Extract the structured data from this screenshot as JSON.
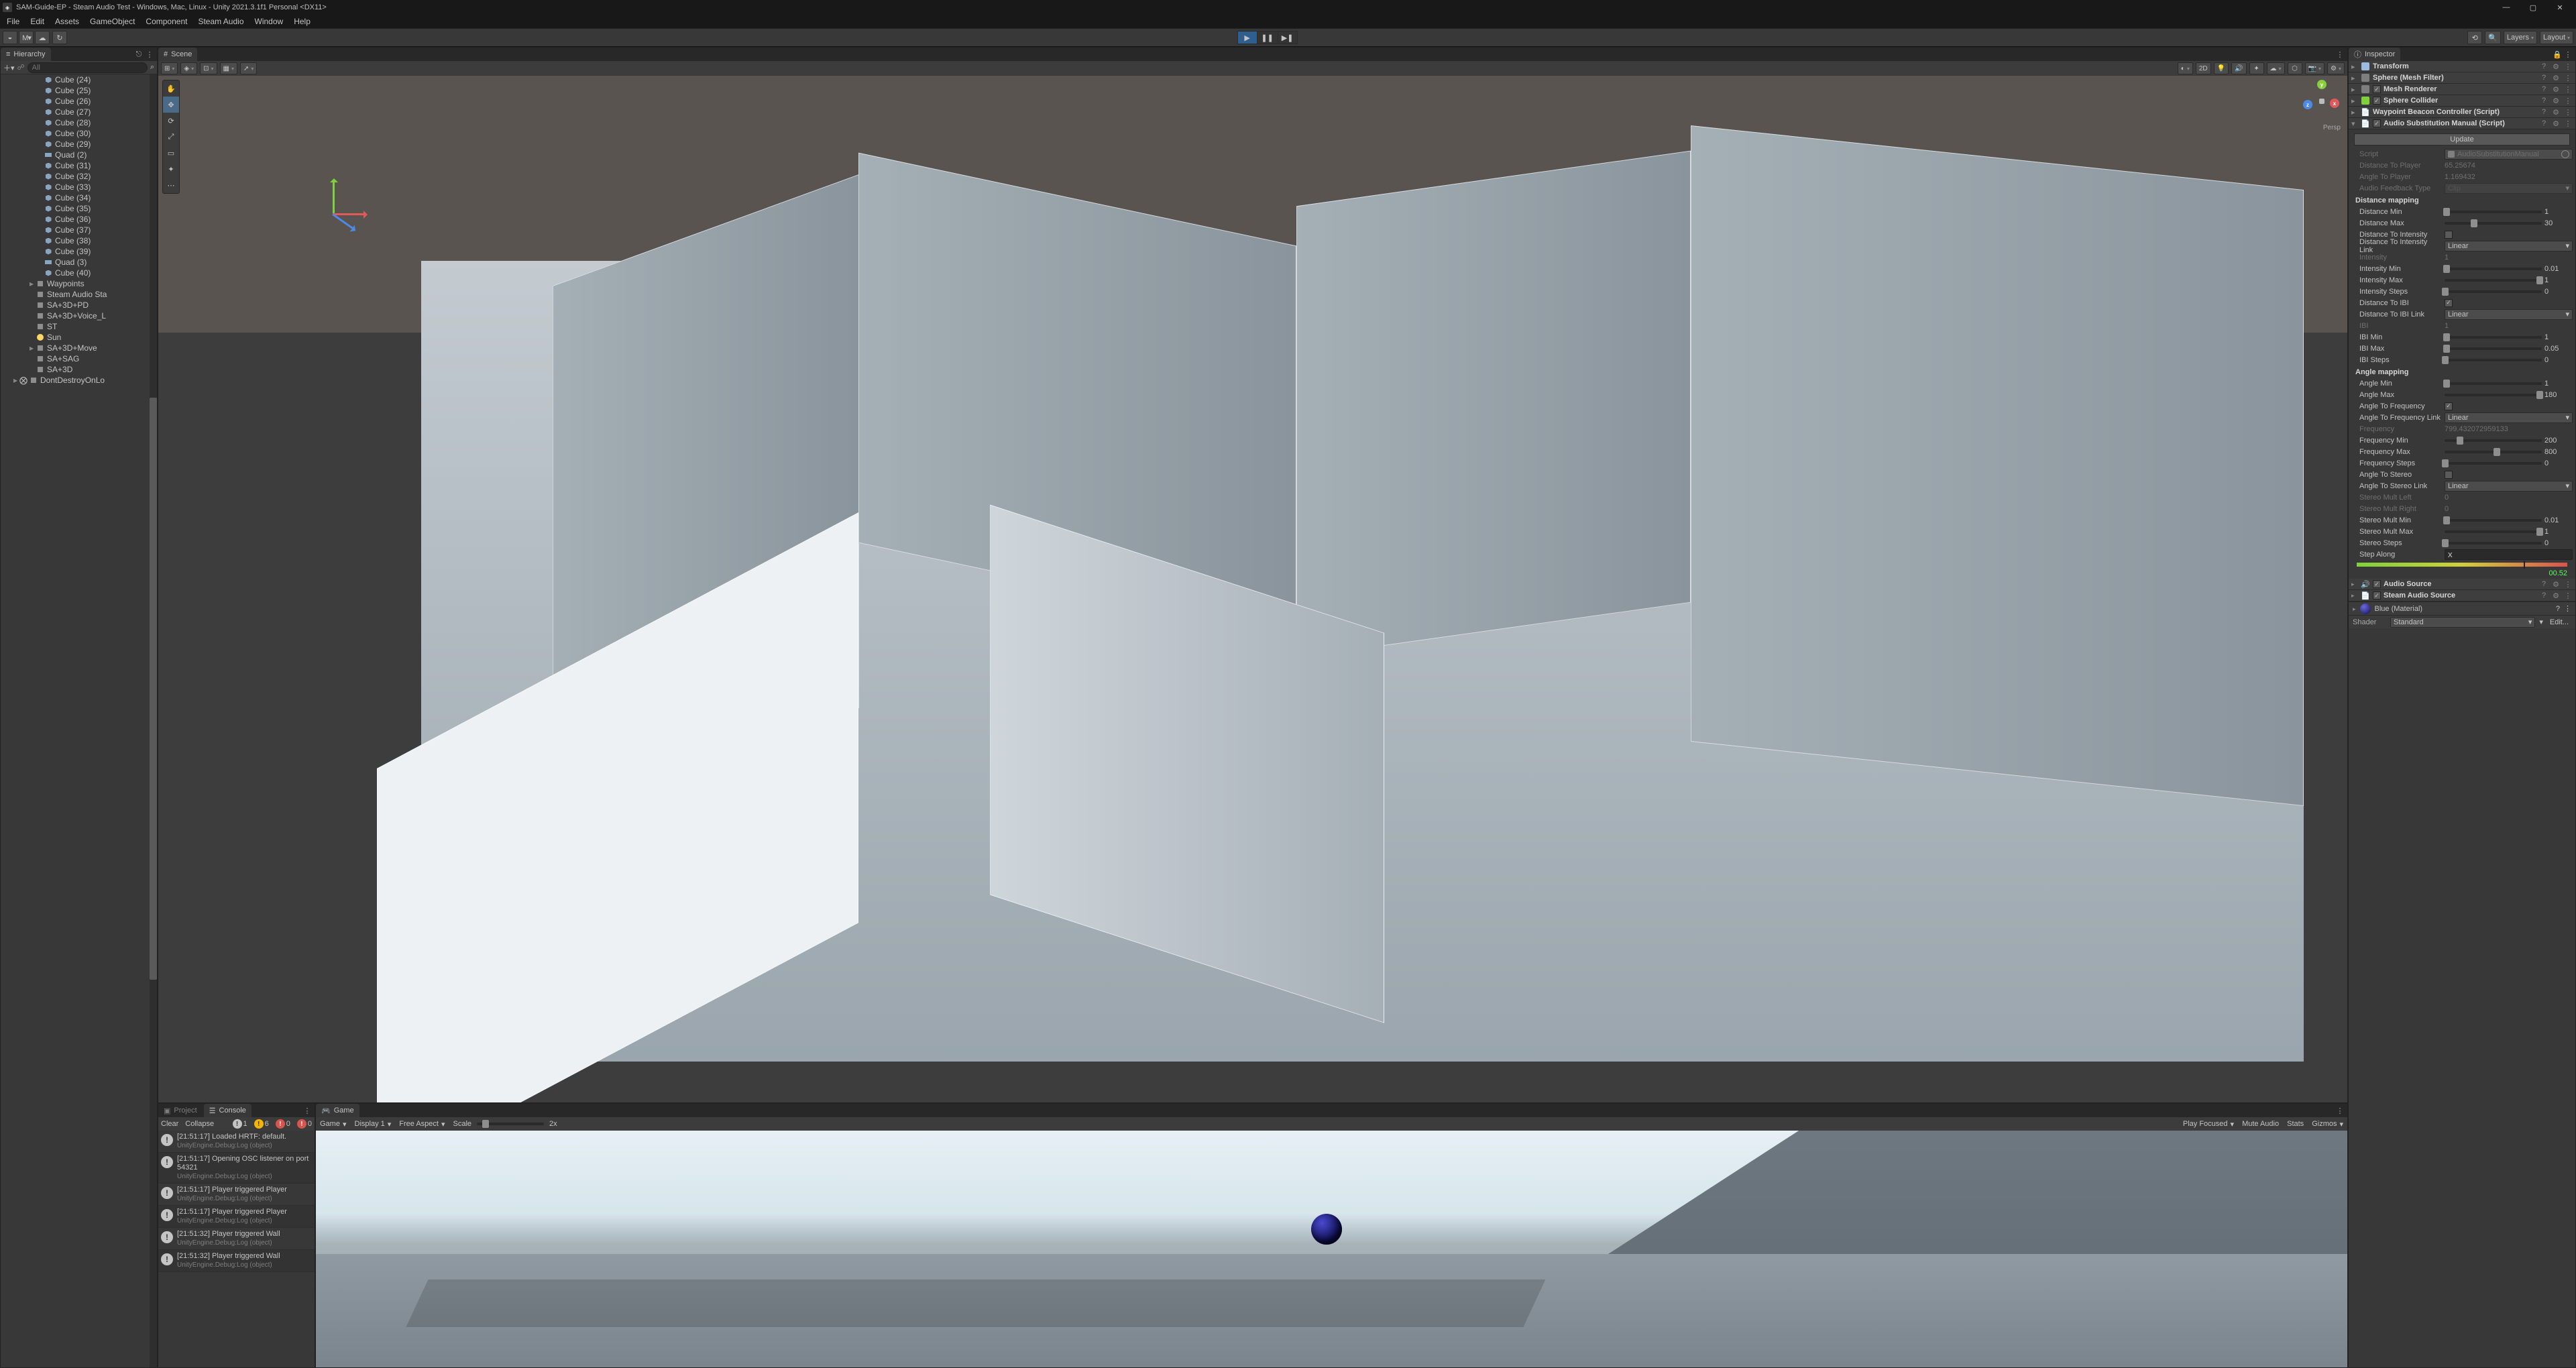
{
  "window_title": "SAM-Guide-EP - Steam Audio Test - Windows, Mac, Linux - Unity 2021.3.1f1 Personal <DX11>",
  "menu": [
    "File",
    "Edit",
    "Assets",
    "GameObject",
    "Component",
    "Steam Audio",
    "Window",
    "Help"
  ],
  "toolbar_right": {
    "layers": "Layers",
    "layout": "Layout"
  },
  "hierarchy": {
    "tab": "Hierarchy",
    "search_placeholder": "All",
    "items": [
      {
        "label": "Cube (24)",
        "icon": "cube",
        "depth": 4
      },
      {
        "label": "Cube (25)",
        "icon": "cube",
        "depth": 4
      },
      {
        "label": "Cube (26)",
        "icon": "cube",
        "depth": 4
      },
      {
        "label": "Cube (27)",
        "icon": "cube",
        "depth": 4
      },
      {
        "label": "Cube (28)",
        "icon": "cube",
        "depth": 4
      },
      {
        "label": "Cube (30)",
        "icon": "cube",
        "depth": 4
      },
      {
        "label": "Cube (29)",
        "icon": "cube",
        "depth": 4
      },
      {
        "label": "Quad (2)",
        "icon": "flat",
        "depth": 4
      },
      {
        "label": "Cube (31)",
        "icon": "cube",
        "depth": 4
      },
      {
        "label": "Cube (32)",
        "icon": "cube",
        "depth": 4
      },
      {
        "label": "Cube (33)",
        "icon": "cube",
        "depth": 4
      },
      {
        "label": "Cube (34)",
        "icon": "cube",
        "depth": 4
      },
      {
        "label": "Cube (35)",
        "icon": "cube",
        "depth": 4
      },
      {
        "label": "Cube (36)",
        "icon": "cube",
        "depth": 4
      },
      {
        "label": "Cube (37)",
        "icon": "cube",
        "depth": 4
      },
      {
        "label": "Cube (38)",
        "icon": "cube",
        "depth": 4
      },
      {
        "label": "Cube (39)",
        "icon": "cube",
        "depth": 4
      },
      {
        "label": "Quad (3)",
        "icon": "flat",
        "depth": 4
      },
      {
        "label": "Cube (40)",
        "icon": "cube",
        "depth": 4
      },
      {
        "label": "Waypoints",
        "icon": "node",
        "depth": 3,
        "exp": "▸"
      },
      {
        "label": "Steam Audio Sta",
        "icon": "node",
        "depth": 3
      },
      {
        "label": "SA+3D+PD",
        "icon": "node",
        "depth": 3
      },
      {
        "label": "SA+3D+Voice_L",
        "icon": "node",
        "depth": 3
      },
      {
        "label": "ST",
        "icon": "node",
        "depth": 3
      },
      {
        "label": "Sun",
        "icon": "light",
        "depth": 3
      },
      {
        "label": "SA+3D+Move",
        "icon": "node",
        "depth": 3,
        "exp": "▸"
      },
      {
        "label": "SA+SAG",
        "icon": "node",
        "depth": 3
      },
      {
        "label": "SA+3D",
        "icon": "node",
        "depth": 3
      },
      {
        "label": "DontDestroyOnLo",
        "icon": "node",
        "depth": 1,
        "exp": "▸",
        "pre": "⨂"
      }
    ]
  },
  "scene": {
    "tab": "Scene",
    "persp": "Persp",
    "mode_2d": "2D"
  },
  "project_console": {
    "project_tab": "Project",
    "console_tab": "Console"
  },
  "console": {
    "clear": "Clear",
    "collapse": "Collapse",
    "badges": {
      "info_count": "1",
      "warn_count": "6",
      "err_count": "0",
      "err2_count": "0"
    },
    "logs": [
      {
        "t": "[21:51:17] Loaded HRTF: default.",
        "s": "UnityEngine.Debug:Log (object)"
      },
      {
        "t": "[21:51:17] Opening OSC listener on port 54321",
        "s": "UnityEngine.Debug:Log (object)"
      },
      {
        "t": "[21:51:17] Player triggered Player",
        "s": "UnityEngine.Debug:Log (object)"
      },
      {
        "t": "[21:51:17] Player triggered Player",
        "s": "UnityEngine.Debug:Log (object)"
      },
      {
        "t": "[21:51:32] Player triggered Wall",
        "s": "UnityEngine.Debug:Log (object)"
      },
      {
        "t": "[21:51:32] Player triggered Wall",
        "s": "UnityEngine.Debug:Log (object)"
      }
    ]
  },
  "game": {
    "tab": "Game",
    "source": "Game",
    "display": "Display 1",
    "aspect": "Free Aspect",
    "scale": "Scale",
    "scale_val": "2x",
    "play_focused": "Play Focused",
    "mute": "Mute Audio",
    "stats": "Stats",
    "gizmos": "Gizmos"
  },
  "inspector": {
    "tab": "Inspector",
    "components": [
      {
        "title": "Transform",
        "fold": "▸",
        "iconcolor": "#9bbce0"
      },
      {
        "title": "Sphere (Mesh Filter)",
        "fold": "▸",
        "iconcolor": "#7e7e7e"
      },
      {
        "title": "Mesh Renderer",
        "fold": "▸",
        "chk": true,
        "iconcolor": "#7e7e7e"
      },
      {
        "title": "Sphere Collider",
        "fold": "▸",
        "chk": true,
        "iconcolor": "#7fd13b"
      },
      {
        "title": "Waypoint Beacon Controller (Script)",
        "fold": "▸",
        "iconcolor": "#c4c4c4",
        "scripticon": true
      },
      {
        "title": "Audio Substitution Manual (Script)",
        "fold": "▾",
        "chk": true,
        "iconcolor": "#c4c4c4",
        "scripticon": true
      }
    ],
    "update": "Update",
    "script_label": "Script",
    "script_value": "AudioSubstitutionManual",
    "distance_to_player_l": "Distance To Player",
    "distance_to_player_v": "65.25674",
    "angle_to_player_l": "Angle To Player",
    "angle_to_player_v": "1.169432",
    "audio_feedback_type_l": "Audio Feedback Type",
    "audio_feedback_type_v": "Clip",
    "sec_distance": "Distance mapping",
    "distance_min_l": "Distance Min",
    "distance_min_v": "1",
    "distance_max_l": "Distance Max",
    "distance_max_v": "30",
    "distance_to_intensity_l": "Distance To Intensity",
    "distance_to_intensity_link_l": "Distance To Intensity Link",
    "distance_to_intensity_link_v": "Linear",
    "intensity_l": "Intensity",
    "intensity_v": "1",
    "intensity_min_l": "Intensity Min",
    "intensity_min_v": "0.01",
    "intensity_max_l": "Intensity Max",
    "intensity_max_v": "1",
    "intensity_steps_l": "Intensity Steps",
    "intensity_steps_v": "0",
    "distance_to_ibi_l": "Distance To IBI",
    "distance_to_ibi_link_l": "Distance To IBI Link",
    "distance_to_ibi_link_v": "Linear",
    "ibi_l": "IBI",
    "ibi_v": "1",
    "ibi_min_l": "IBI Min",
    "ibi_min_v": "1",
    "ibi_max_l": "IBI Max",
    "ibi_max_v": "0.05",
    "ibi_steps_l": "IBI Steps",
    "ibi_steps_v": "0",
    "sec_angle": "Angle mapping",
    "angle_min_l": "Angle Min",
    "angle_min_v": "1",
    "angle_max_l": "Angle Max",
    "angle_max_v": "180",
    "angle_to_frequency_l": "Angle To Frequency",
    "angle_to_frequency_link_l": "Angle To Frequency Link",
    "angle_to_frequency_link_v": "Linear",
    "frequency_l": "Frequency",
    "frequency_v": "799.432072959133",
    "frequency_min_l": "Frequency Min",
    "frequency_min_v": "200",
    "frequency_max_l": "Frequency Max",
    "frequency_max_v": "800",
    "frequency_steps_l": "Frequency Steps",
    "frequency_steps_v": "0",
    "angle_to_stereo_l": "Angle To Stereo",
    "angle_to_stereo_link_l": "Angle To Stereo Link",
    "angle_to_stereo_link_v": "Linear",
    "stereo_mult_left_l": "Stereo Mult Left",
    "stereo_mult_left_v": "0",
    "stereo_mult_right_l": "Stereo Mult Right",
    "stereo_mult_right_v": "0",
    "stereo_mult_min_l": "Stereo Mult Min",
    "stereo_mult_min_v": "0.01",
    "stereo_mult_max_l": "Stereo Mult Max",
    "stereo_mult_max_v": "1",
    "stereo_steps_l": "Stereo Steps",
    "stereo_steps_v": "0",
    "step_along_l": "Step Along",
    "step_along_v": "x",
    "audio_readout": "00.52",
    "audio_source": "Audio Source",
    "steam_audio_source": "Steam Audio Source",
    "material_name": "Blue (Material)",
    "shader_l": "Shader",
    "shader_v": "Standard",
    "edit": "Edit..."
  }
}
